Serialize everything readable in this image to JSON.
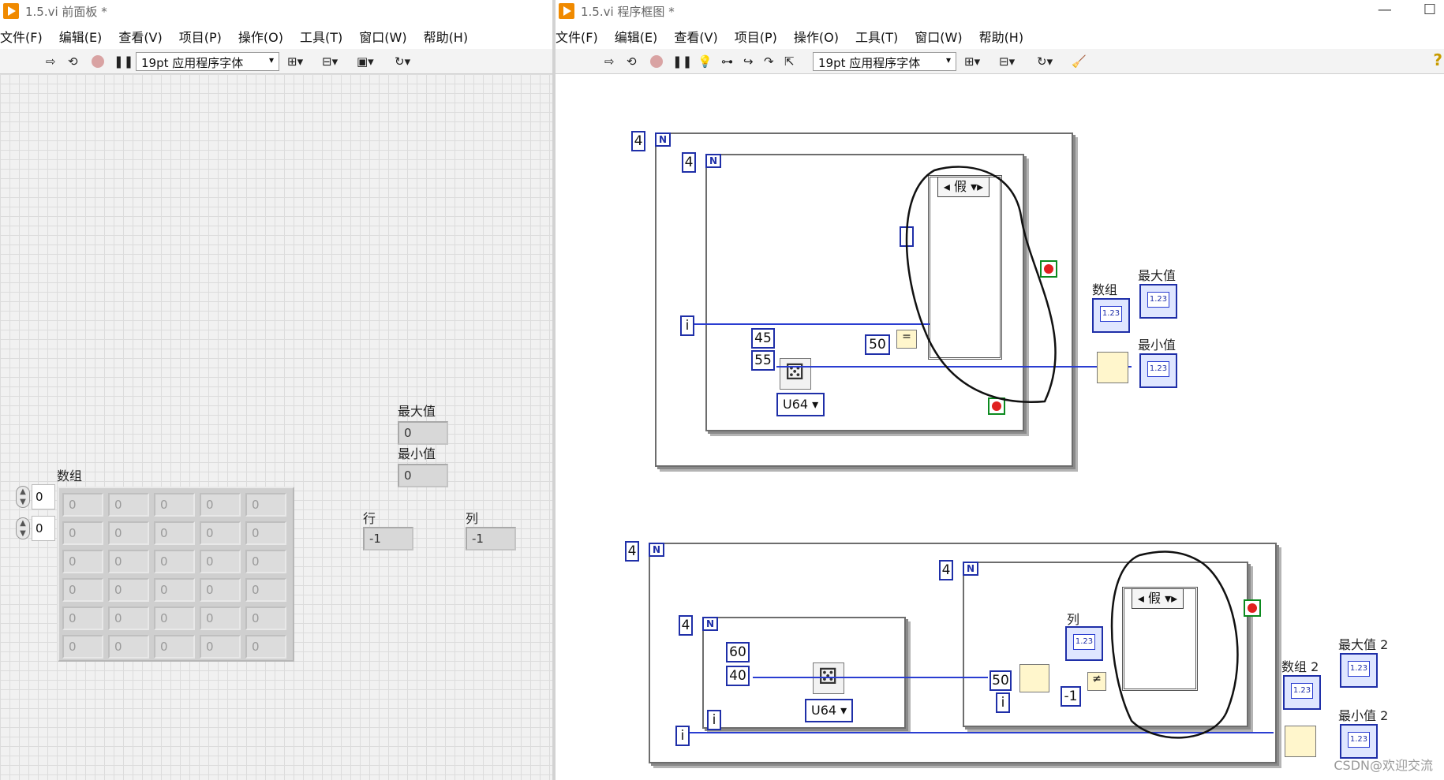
{
  "front_panel": {
    "title": "1.5.vi 前面板 *",
    "menu": [
      "文件(F)",
      "编辑(E)",
      "查看(V)",
      "项目(P)",
      "操作(O)",
      "工具(T)",
      "窗口(W)",
      "帮助(H)"
    ],
    "font_select": "19pt 应用程序字体",
    "array_label": "数组",
    "array_index": [
      "0",
      "0"
    ],
    "array_cells": [
      [
        "0",
        "0",
        "0",
        "0",
        "0"
      ],
      [
        "0",
        "0",
        "0",
        "0",
        "0"
      ],
      [
        "0",
        "0",
        "0",
        "0",
        "0"
      ],
      [
        "0",
        "0",
        "0",
        "0",
        "0"
      ],
      [
        "0",
        "0",
        "0",
        "0",
        "0"
      ],
      [
        "0",
        "0",
        "0",
        "0",
        "0"
      ]
    ],
    "max_label": "最大值",
    "max_value": "0",
    "min_label": "最小值",
    "min_value": "0",
    "row_label": "行",
    "row_value": "-1",
    "col_label": "列",
    "col_value": "-1"
  },
  "block_diagram": {
    "title": "1.5.vi 程序框图 *",
    "menu": [
      "文件(F)",
      "编辑(E)",
      "查看(V)",
      "项目(P)",
      "操作(O)",
      "工具(T)",
      "窗口(W)",
      "帮助(H)"
    ],
    "font_select": "19pt 应用程序字体",
    "top": {
      "outer_count": "4",
      "inner_count": "4",
      "case_label": "假",
      "const_45": "45",
      "const_55": "55",
      "const_50": "50",
      "dtype": "U64",
      "array_label": "数组",
      "max_label": "最大值",
      "min_label": "最小值",
      "i_label": "i"
    },
    "bottom": {
      "outer_count": "4",
      "inner_count_a": "4",
      "inner_count_b": "4",
      "case_label": "假",
      "const_60": "60",
      "const_40": "40",
      "const_50": "50",
      "const_neg1": "-1",
      "dtype": "U64",
      "col_label": "列",
      "array_label": "数组 2",
      "max_label": "最大值 2",
      "min_label": "最小值 2",
      "i_label": "i"
    },
    "watermark": "CSDN@欢迎交流"
  },
  "colors": {
    "wire": "#2a3dd1",
    "stop_green": "#0b8a1e",
    "stop_red": "#e02020",
    "vi_icon": "#f08a00"
  },
  "icons": [
    "run-arrow-icon",
    "run-continuous-icon",
    "abort-icon",
    "pause-icon",
    "highlight-bulb-icon",
    "retain-wire-icon",
    "step-into-icon",
    "step-over-icon",
    "step-out-icon",
    "align-icon",
    "distribute-icon",
    "resize-icon",
    "reorder-icon",
    "cleanup-icon",
    "help-icon"
  ]
}
